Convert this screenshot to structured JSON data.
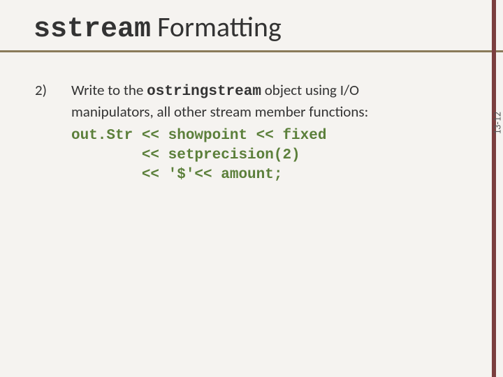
{
  "title": {
    "mono": "sstream",
    "rest": " Formatting"
  },
  "item": {
    "number": "2)",
    "line1_prefix": "Write to the ",
    "line1_mono": "ostringstream",
    "line1_suffix": " object using I/O",
    "line2": "manipulators, all other stream member functions:"
  },
  "code": "out.Str << showpoint << fixed\n        << setprecision(2)\n        << '$'<< amount;",
  "page_label": "13-12"
}
